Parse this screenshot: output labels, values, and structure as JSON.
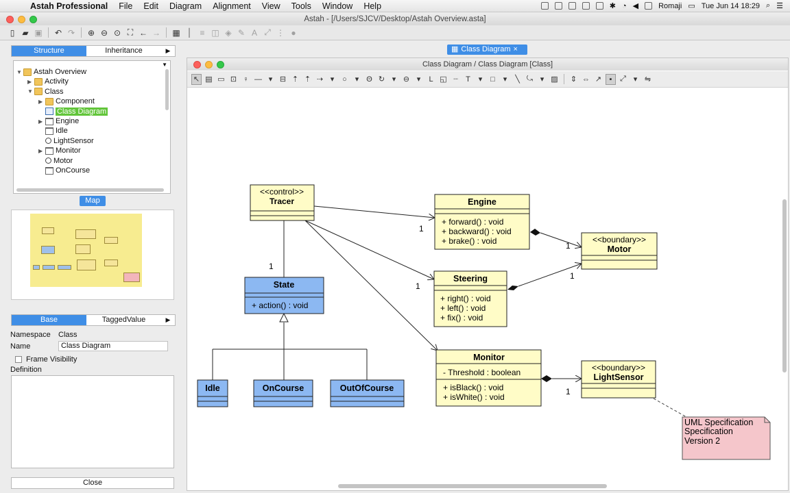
{
  "menubar": {
    "apple": "",
    "app_name": "Astah Professional",
    "menus": [
      "File",
      "Edit",
      "Diagram",
      "Alignment",
      "View",
      "Tools",
      "Window",
      "Help"
    ],
    "status_input": "Romaji",
    "clock": "Tue Jun 14  18:29"
  },
  "window": {
    "title": "Astah - [/Users/SJCV/Desktop/Astah Overview.asta]"
  },
  "structure_tabs": [
    "Structure",
    "Inheritance"
  ],
  "tree": [
    {
      "label": "Astah Overview",
      "icon": "folder",
      "expand": "▼",
      "indent": 0
    },
    {
      "label": "Activity",
      "icon": "folder",
      "expand": "▶",
      "indent": 1
    },
    {
      "label": "Class",
      "icon": "folder",
      "expand": "▼",
      "indent": 1
    },
    {
      "label": "Component",
      "icon": "folder",
      "expand": "▶",
      "indent": 2
    },
    {
      "label": "Class Diagram",
      "icon": "diagram",
      "expand": "",
      "indent": 2,
      "selected": true
    },
    {
      "label": "Engine",
      "icon": "class",
      "expand": "▶",
      "indent": 2
    },
    {
      "label": "Idle",
      "icon": "class",
      "expand": "",
      "indent": 2
    },
    {
      "label": "LightSensor",
      "icon": "boundary",
      "expand": "",
      "indent": 2
    },
    {
      "label": "Monitor",
      "icon": "class",
      "expand": "▶",
      "indent": 2
    },
    {
      "label": "Motor",
      "icon": "boundary",
      "expand": "",
      "indent": 2
    },
    {
      "label": "OnCourse",
      "icon": "class",
      "expand": "",
      "indent": 2
    }
  ],
  "map_label": "Map",
  "property_tabs": [
    "Base",
    "TaggedValue"
  ],
  "properties": {
    "namespace_label": "Namespace",
    "namespace_value": "Class",
    "name_label": "Name",
    "name_value": "Class Diagram",
    "frame_visibility_label": "Frame Visibility",
    "definition_label": "Definition",
    "close_label": "Close"
  },
  "editor": {
    "tab_label": "Class Diagram",
    "diagram_title": "Class Diagram / Class Diagram [Class]"
  },
  "colors": {
    "class_fill": "#fffcc7",
    "state_fill": "#8cb8f2",
    "note_fill": "#f5c6cb",
    "accent": "#3f8ee6",
    "selection": "#62c53a"
  },
  "diagram": {
    "classes": {
      "tracer": {
        "stereotype": "<<control>>",
        "name": "Tracer"
      },
      "engine": {
        "name": "Engine",
        "operations": [
          "+ forward() : void",
          "+ backward() : void",
          "+ brake() : void"
        ]
      },
      "motor": {
        "stereotype": "<<boundary>>",
        "name": "Motor"
      },
      "steering": {
        "name": "Steering",
        "operations": [
          "+ right() : void",
          "+ left() : void",
          "+ fix() : void"
        ]
      },
      "state": {
        "name": "State",
        "operations": [
          "+ action() : void"
        ]
      },
      "monitor": {
        "name": "Monitor",
        "attributes": [
          "- Threshold : boolean"
        ],
        "operations": [
          "+ isBlack() : void",
          "+ isWhite() : void"
        ]
      },
      "lightsensor": {
        "stereotype": "<<boundary>>",
        "name": "LightSensor"
      },
      "idle": {
        "name": "Idle"
      },
      "oncourse": {
        "name": "OnCourse"
      },
      "outofcourse": {
        "name": "OutOfCourse"
      }
    },
    "note_lines": [
      "UML Specification",
      "Specification",
      "Version 2"
    ],
    "multiplicities": {
      "engine": "1",
      "steering": "1",
      "state": "1",
      "motor_from_engine": "1",
      "motor_from_steering": "1",
      "lightsensor": "1"
    }
  }
}
